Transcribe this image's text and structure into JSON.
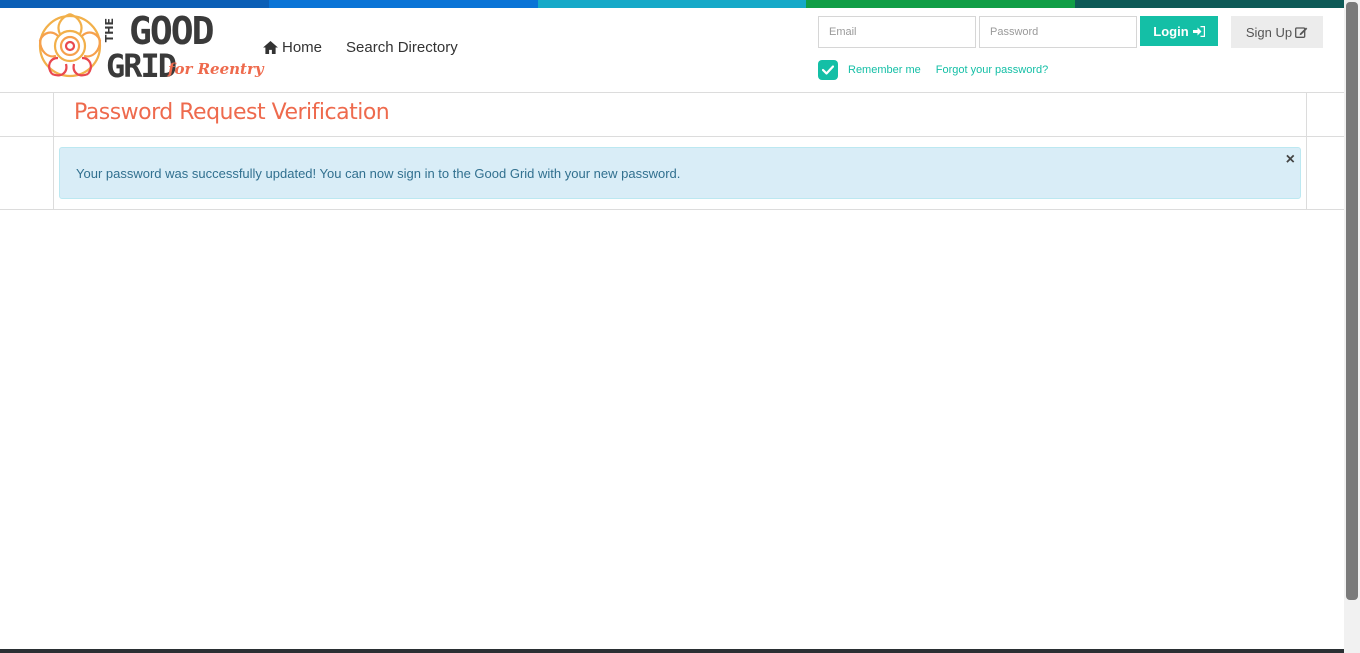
{
  "brand": {
    "the": "THE",
    "good": "GOOD",
    "grid": "GRID",
    "tagline": "for Reentry"
  },
  "stripe_colors": [
    "#0b5fb6",
    "#0a74d6",
    "#16a9c8",
    "#119e46",
    "#0e5a57"
  ],
  "nav": {
    "home": "Home",
    "search_directory": "Search Directory"
  },
  "login": {
    "email_placeholder": "Email",
    "password_placeholder": "Password",
    "login_label": "Login",
    "signup_label": "Sign Up",
    "remember_me": "Remember me",
    "remember_checked": true,
    "forgot_password": "Forgot your password?"
  },
  "page": {
    "title": "Password Request Verification",
    "alert_message": "Your password was successfully updated! You can now sign in to the Good Grid with your new password.",
    "alert_close": "×"
  },
  "colors": {
    "accent_teal": "#14bfa6",
    "title_coral": "#ee6a4d",
    "alert_bg": "#d9edf7",
    "alert_text": "#31708f"
  }
}
